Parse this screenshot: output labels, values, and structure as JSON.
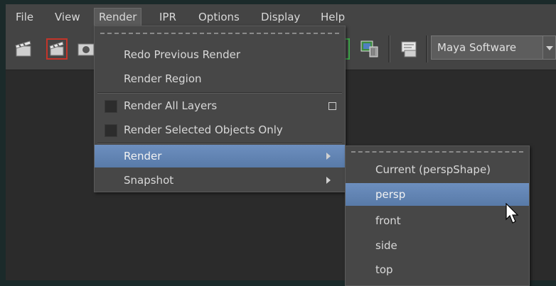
{
  "menubar": {
    "items": [
      {
        "label": "File"
      },
      {
        "label": "View"
      },
      {
        "label": "Render"
      },
      {
        "label": "IPR"
      },
      {
        "label": "Options"
      },
      {
        "label": "Display"
      },
      {
        "label": "Help"
      }
    ],
    "active": "Render"
  },
  "toolbar": {
    "icons": [
      "render-clapper-icon",
      "ipr-render-icon",
      "snapshot-icon",
      "keep-image-icon",
      "remove-image-icon",
      "render-settings-icon"
    ],
    "renderer": "Maya Software"
  },
  "render_menu": {
    "items": [
      {
        "label": "Redo Previous Render"
      },
      {
        "label": "Render Region"
      },
      {
        "label": "Render All Layers",
        "checkbox": true,
        "option_box": true
      },
      {
        "label": "Render Selected Objects Only",
        "checkbox": true
      },
      {
        "label": "Render",
        "submenu": true,
        "highlighted": true
      },
      {
        "label": "Snapshot",
        "submenu": true
      }
    ]
  },
  "render_submenu": {
    "items": [
      {
        "label": "Current (perspShape)"
      },
      {
        "label": "persp",
        "highlighted": true
      },
      {
        "label": "front"
      },
      {
        "label": "side"
      },
      {
        "label": "top"
      }
    ]
  },
  "colors": {
    "highlight": "#6283b3",
    "menu_bg": "#474747",
    "bar_bg": "#444444"
  }
}
